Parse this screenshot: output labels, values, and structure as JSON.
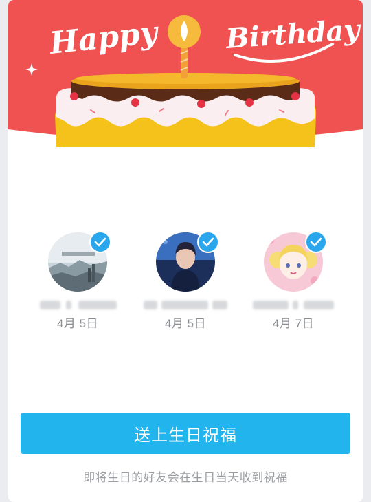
{
  "banner": {
    "title_left": "Happy",
    "title_right": "Birthday",
    "background_color": "#f05252"
  },
  "friends": [
    {
      "name": "",
      "date": "4月 5日",
      "selected": true,
      "avatar": "landscape-avatar"
    },
    {
      "name": "",
      "date": "4月 5日",
      "selected": true,
      "avatar": "portrait-avatar"
    },
    {
      "name": "",
      "date": "4月 7日",
      "selected": true,
      "avatar": "anime-avatar"
    }
  ],
  "actions": {
    "send_label": "送上生日祝福",
    "send_color": "#22b5ed"
  },
  "footer": {
    "hint": "即将生日的好友会在生日当天收到祝福"
  },
  "icons": {
    "check": "check-icon",
    "candle": "candle-icon",
    "sparkle": "sparkle-icon"
  }
}
